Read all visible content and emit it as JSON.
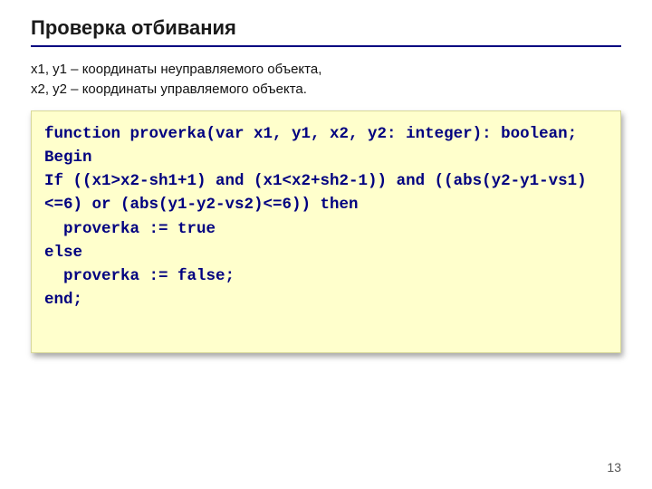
{
  "title": "Проверка отбивания",
  "description": "x1, y1 – координаты неуправляемого объекта,\nx2, y2 – координаты управляемого объекта.",
  "code": "function proverka(var x1, y1, x2, y2: integer): boolean;\nBegin\nIf ((x1>x2-sh1+1) and (x1<x2+sh2-1)) and ((abs(y2-y1-vs1)<=6) or (abs(y1-y2-vs2)<=6)) then\n  proverka := true\nelse\n  proverka := false;\nend;",
  "page_number": "13"
}
